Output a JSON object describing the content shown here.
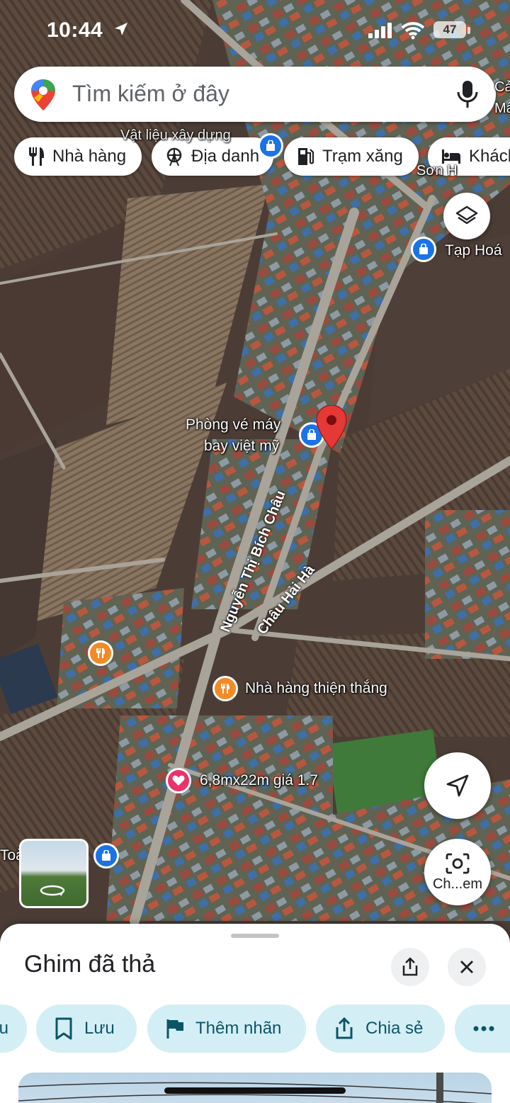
{
  "status_bar": {
    "time": "10:44",
    "battery": "47"
  },
  "search": {
    "placeholder": "Tìm kiếm ở đây"
  },
  "categories": [
    {
      "label": "Nhà hàng",
      "icon": "fork-knife-icon"
    },
    {
      "label": "Địa danh",
      "icon": "ferris-wheel-icon"
    },
    {
      "label": "Trạm xăng",
      "icon": "gas-pump-icon"
    },
    {
      "label": "Khách",
      "icon": "bed-icon"
    }
  ],
  "map": {
    "labels": {
      "vat_lieu": "Vật liệu xây dựng",
      "tap_hoa": "Tạp Hoá",
      "son": "Sơn H",
      "top_right_1": "Cả",
      "top_right_2": "Mấy",
      "phong_ve_1": "Phòng vé máy",
      "phong_ve_2": "bay việt mỹ",
      "nha_hang": "Nhà hàng thiện thắng",
      "dat": "6,8mx22m giá 1.7",
      "toa": "Toà"
    },
    "roads": {
      "nguyen": "Nguyễn Thị Bích Châu",
      "chau": "Châu Hải Hà"
    },
    "colors": {
      "pin": "#e53935",
      "shop": "#1a73e8",
      "food": "#f28b25",
      "saved": "#e8336b"
    }
  },
  "fabs": {
    "camera_label": "Ch...em"
  },
  "sheet": {
    "title": "Ghim đã thả",
    "actions": [
      {
        "label": "u",
        "icon": "directions-icon"
      },
      {
        "label": "Lưu",
        "icon": "bookmark-icon"
      },
      {
        "label": "Thêm nhãn",
        "icon": "flag-icon"
      },
      {
        "label": "Chia sẻ",
        "icon": "share-icon"
      },
      {
        "label": "",
        "icon": "more-icon"
      }
    ]
  }
}
